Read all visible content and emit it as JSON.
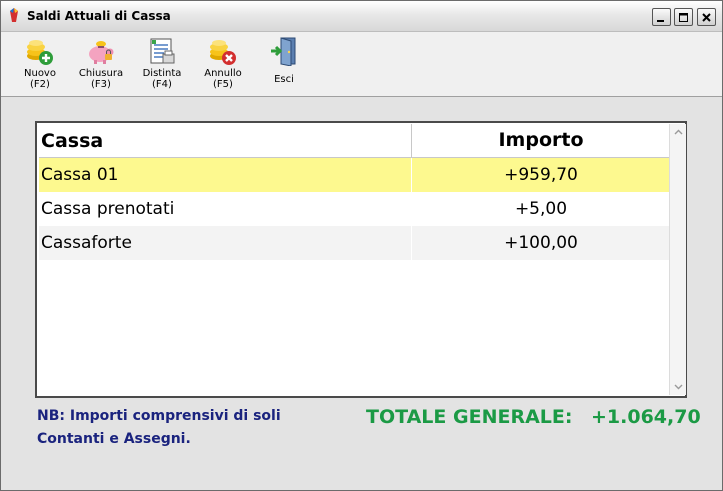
{
  "window": {
    "title": "Saldi Attuali di Cassa"
  },
  "toolbar": {
    "buttons": [
      {
        "label": "Nuovo",
        "key": "(F2)",
        "icon": "coins-add-icon"
      },
      {
        "label": "Chiusura",
        "key": "(F3)",
        "icon": "piggy-bank-icon"
      },
      {
        "label": "Distinta",
        "key": "(F4)",
        "icon": "document-list-icon"
      },
      {
        "label": "Annullo",
        "key": "(F5)",
        "icon": "coins-cancel-icon"
      },
      {
        "label": "Esci",
        "key": "",
        "icon": "exit-door-icon"
      }
    ]
  },
  "table": {
    "headers": [
      "Cassa",
      "Importo"
    ],
    "rows": [
      {
        "cassa": "Cassa 01",
        "importo": "+959,70",
        "selected": true
      },
      {
        "cassa": "Cassa prenotati",
        "importo": "+5,00",
        "selected": false
      },
      {
        "cassa": "Cassaforte",
        "importo": "+100,00",
        "selected": false
      }
    ]
  },
  "note": {
    "line1": "NB: Importi comprensivi di soli",
    "line2": "Contanti e Assegni."
  },
  "totals": {
    "label": "TOTALE GENERALE:",
    "value": "+1.064,70"
  },
  "colors": {
    "selected_row": "#fdf98f",
    "total_text": "#1b9a45",
    "note_text": "#1a237e",
    "alt_row": "#f3f3f3"
  }
}
